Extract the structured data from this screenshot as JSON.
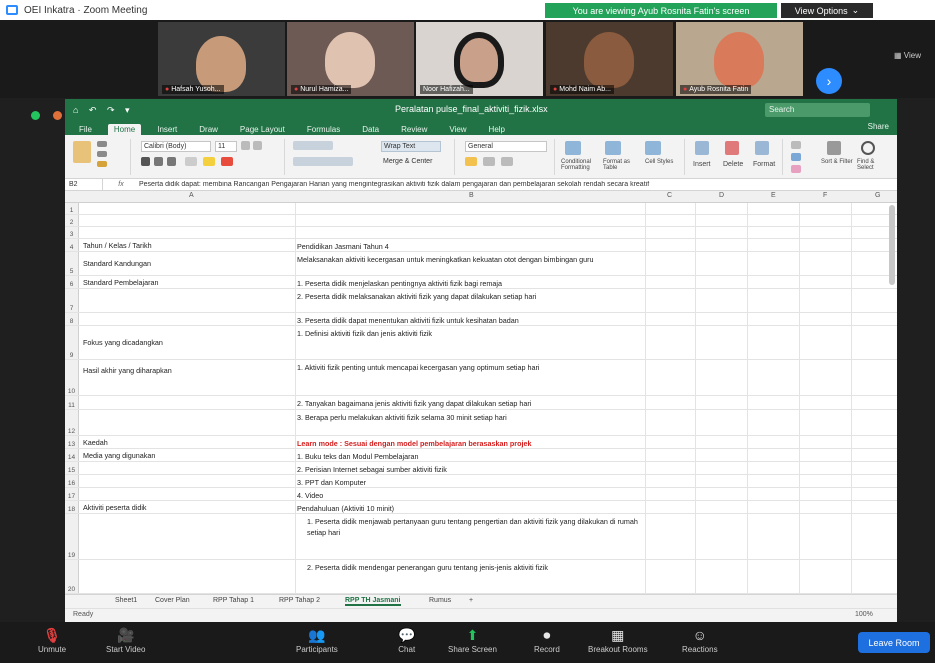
{
  "window": {
    "title": "OEI Inkatra · Zoom Meeting"
  },
  "share_banner": "You are viewing Ayub Rosnita Fatin's screen",
  "view_options": "View Options",
  "view_options_arrow": "⌄",
  "gallery": {
    "participants": [
      {
        "name": "Hafsah Yusoh..."
      },
      {
        "name": "Nurul Hamiza..."
      },
      {
        "name": "Noor Hafizah..."
      },
      {
        "name": "Mohd Naim Ab..."
      },
      {
        "name": "Ayub Rosnita Fatin"
      }
    ],
    "next": "›",
    "view_label": "▦ View"
  },
  "excel": {
    "quick_access": "⌂ ↶ ↷ ▾",
    "doc_title": "Peralatan pulse_final_aktiviti_fizik.xlsx",
    "search": "Search",
    "tabs": [
      "File",
      "Home",
      "Insert",
      "Draw",
      "Page Layout",
      "Formulas",
      "Data",
      "Review",
      "View",
      "Help"
    ],
    "active_tab": "Home",
    "share": "Share",
    "ribbon": {
      "font_name": "Calibri (Body)",
      "font_size": "11",
      "wrap": "Wrap Text",
      "merge": "Merge & Center",
      "number_format": "General",
      "conditional": "Conditional Formatting",
      "format_table": "Format as Table",
      "cell_styles": "Cell Styles",
      "insert": "Insert",
      "delete": "Delete",
      "format": "Format",
      "sort": "Sort & Filter",
      "find": "Find & Select"
    },
    "name_box": "B2",
    "formula_fx": "fx",
    "formula_text": "Peserta didik dapat: membina Rancangan Pengajaran Harian yang mengintegrasikan aktiviti fizik dalam pengajaran dan pembelajaran sekolah rendah secara kreatif",
    "columns": [
      "A",
      "B",
      "C",
      "D",
      "E",
      "F",
      "G"
    ],
    "rows": [
      {
        "n": "1",
        "a": "",
        "b": ""
      },
      {
        "n": "2",
        "a": "",
        "b": ""
      },
      {
        "n": "3",
        "a": "",
        "b": ""
      },
      {
        "n": "4",
        "a": "Tahun / Kelas / Tarikh",
        "b": "Pendidikan Jasmani Tahun 4"
      },
      {
        "n": "5",
        "a": "Standard Kandungan",
        "b": "Melaksanakan aktiviti kecergasan untuk meningkatkan kekuatan otot dengan bimbingan guru"
      },
      {
        "n": "6",
        "a": "Standard Pembelajaran",
        "b": "1. Peserta didik menjelaskan pentingnya aktiviti fizik bagi remaja"
      },
      {
        "n": "7",
        "a": "",
        "b": "2. Peserta didik melaksanakan aktiviti fizik yang dapat dilakukan setiap hari"
      },
      {
        "n": "8",
        "a": "",
        "b": "3. Peserta didik dapat menentukan aktiviti fizik untuk kesihatan badan"
      },
      {
        "n": "9",
        "a": "Fokus yang dicadangkan",
        "b": "1. Definisi aktiviti fizik dan jenis aktiviti fizik"
      },
      {
        "n": "10",
        "a": "Hasil akhir yang diharapkan",
        "b": "1. Aktiviti fizik penting untuk mencapai kecergasan yang optimum setiap hari"
      },
      {
        "n": "11",
        "a": "",
        "b": "2. Tanyakan bagaimana jenis aktiviti fizik yang dapat dilakukan setiap hari"
      },
      {
        "n": "12",
        "a": "",
        "b": "3. Berapa perlu melakukan aktiviti fizik selama 30 minit setiap hari"
      },
      {
        "n": "13",
        "a": "Kaedah",
        "b": "Learn mode : Sesuai dengan model pembelajaran berasaskan projek"
      },
      {
        "n": "14",
        "a": "Media yang digunakan",
        "b": "1. Buku teks dan Modul Pembelajaran"
      },
      {
        "n": "15",
        "a": "",
        "b": "2. Perisian Internet sebagai sumber aktiviti fizik"
      },
      {
        "n": "16",
        "a": "",
        "b": "3. PPT dan Komputer"
      },
      {
        "n": "17",
        "a": "",
        "b": "4. Video"
      },
      {
        "n": "18",
        "a": "Aktiviti peserta didik",
        "b": "Pendahuluan (Aktiviti 10 minit)"
      },
      {
        "n": "19",
        "a": "",
        "b": "1. Peserta didik menjawab pertanyaan guru tentang pengertian dan aktiviti fizik yang dilakukan di rumah setiap hari"
      },
      {
        "n": "20",
        "a": "",
        "b": "2. Peserta didik mendengar penerangan guru tentang jenis-jenis aktiviti fizik"
      }
    ],
    "sheets": [
      "Sheet1",
      "Cover Plan",
      "RPP Tahap 1",
      "RPP Tahap 2",
      "RPP TH Jasmani",
      "Rumus",
      "+"
    ],
    "active_sheet": "RPP TH Jasmani",
    "status_left": "Ready",
    "status_right": "100%"
  },
  "toolbar": {
    "leave": "Leave Room",
    "items": [
      {
        "label": "Unmute",
        "icon": "mic-icon",
        "glyph": "🎙"
      },
      {
        "label": "Start Video",
        "icon": "video-icon",
        "glyph": "🎥"
      },
      {
        "label": "Participants",
        "icon": "participants-icon",
        "glyph": "👥"
      },
      {
        "label": "Chat",
        "icon": "chat-icon",
        "glyph": "💬"
      },
      {
        "label": "Share Screen",
        "icon": "share-icon",
        "glyph": "⬆"
      },
      {
        "label": "Record",
        "icon": "record-icon",
        "glyph": "⏺"
      },
      {
        "label": "Breakout Rooms",
        "icon": "breakout-icon",
        "glyph": "▦"
      },
      {
        "label": "Reactions",
        "icon": "reactions-icon",
        "glyph": "☺"
      }
    ]
  },
  "colors": {
    "excel_green": "#217346",
    "zoom_blue": "#2d8cff",
    "share_green": "#23a35a",
    "leave_blue": "#1e6fe0"
  }
}
